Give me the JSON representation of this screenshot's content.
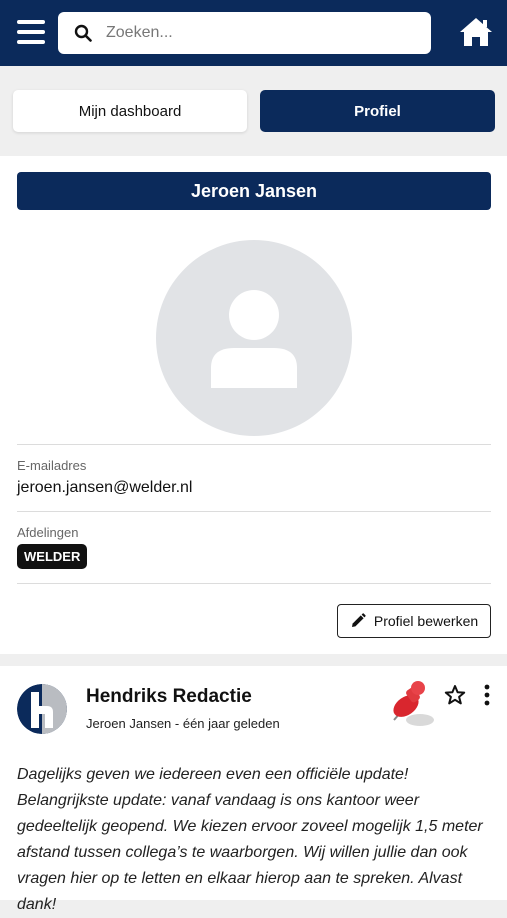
{
  "header": {
    "search_placeholder": "Zoeken...",
    "icons": [
      "menu-icon",
      "search-icon",
      "home-icon"
    ],
    "brand_color": "#0b2a5b"
  },
  "tabs": [
    {
      "label": "Mijn dashboard",
      "active": false
    },
    {
      "label": "Profiel",
      "active": true
    }
  ],
  "profile": {
    "name": "Jeroen Jansen",
    "email_label": "E-mailadres",
    "email": "jeroen.jansen@welder.nl",
    "departments_label": "Afdelingen",
    "department_badge": "WELDER",
    "edit_button": "Profiel bewerken"
  },
  "post": {
    "title": "Hendriks Redactie",
    "meta": "Jeroen Jansen - één jaar geleden",
    "body": "Dagelijks geven we iedereen even een officiële update! Belangrijkste update: vanaf vandaag is ons kantoor weer gedeeltelijk geopend. We kiezen ervoor zoveel mogelijk 1,5 meter afstand tussen collega’s te waarborgen. Wij willen jullie dan ook vragen hier op te letten en elkaar hierop aan te spreken. Alvast dank!"
  }
}
